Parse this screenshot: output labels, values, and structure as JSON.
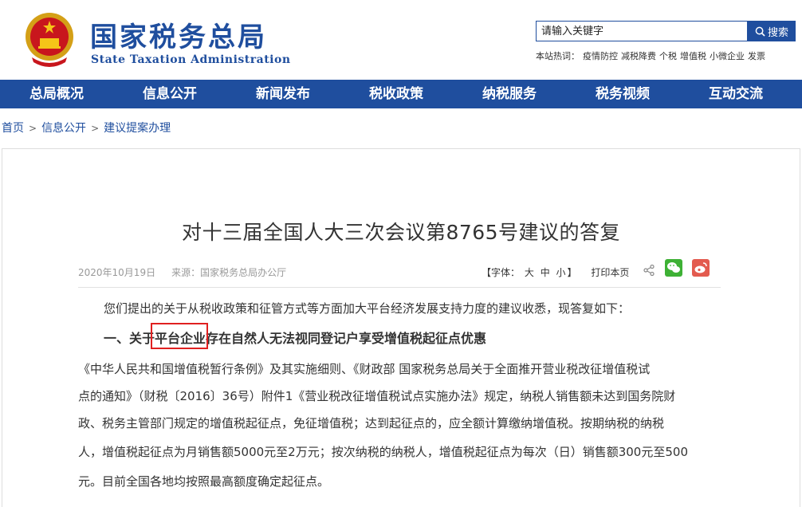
{
  "header": {
    "title_cn": "国家税务总局",
    "title_en": "State Taxation Administration"
  },
  "search": {
    "placeholder": "请输入关键字",
    "button_label": "搜索",
    "hot_label": "本站热词：",
    "hot_words": [
      "疫情防控",
      "减税降费",
      "个税",
      "增值税",
      "小微企业",
      "发票"
    ]
  },
  "nav": {
    "items": [
      "总局概况",
      "信息公开",
      "新闻发布",
      "税收政策",
      "纳税服务",
      "税务视频",
      "互动交流"
    ]
  },
  "breadcrumb": [
    "首页",
    "信息公开",
    "建议提案办理"
  ],
  "article": {
    "title": "对十三届全国人大三次会议第8765号建议的答复",
    "date": "2020年10月19日",
    "source": "来源：国家税务总局办公厅",
    "font_label": "【字体：",
    "font_large": "大",
    "font_medium": "中",
    "font_small": "小",
    "font_close": "】",
    "print": "打印本页",
    "intro": "您们提出的关于从税收政策和征管方式等方面加大平台经济发展支持力度的建议收悉，现答复如下：",
    "heading1_pre": "一、关于",
    "heading1_mid": "平台企业",
    "heading1_post": "存在自然人无法视同登记户享受增值税起征点优惠",
    "body_lines": [
      "《中华人民共和国增值税暂行条例》及其实施细则、《财政部 国家税务总局关于全面推开营业税改征增值税试",
      "点的通知》（财税〔2016〕36号）附件1《营业税改征增值税试点实施办法》规定，纳税人销售额未达到国务院财",
      "政、税务主管部门规定的增值税起征点，免征增值税；达到起征点的，应全额计算缴纳增值税。按期纳税的纳税",
      "人，增值税起征点为月销售额5000元至2万元；按次纳税的纳税人，增值税起征点为每次（日）销售额300元至500",
      "元。目前全国各地均按照最高额度确定起征点。"
    ]
  },
  "icons": [
    "national-emblem-icon",
    "search-icon",
    "share-icon",
    "wechat-icon",
    "weibo-icon"
  ],
  "colors": {
    "brand_blue": "#1f4e9e",
    "highlight_red": "#e02020",
    "wechat_green": "#3eb135",
    "weibo_red": "#e35b4f"
  }
}
